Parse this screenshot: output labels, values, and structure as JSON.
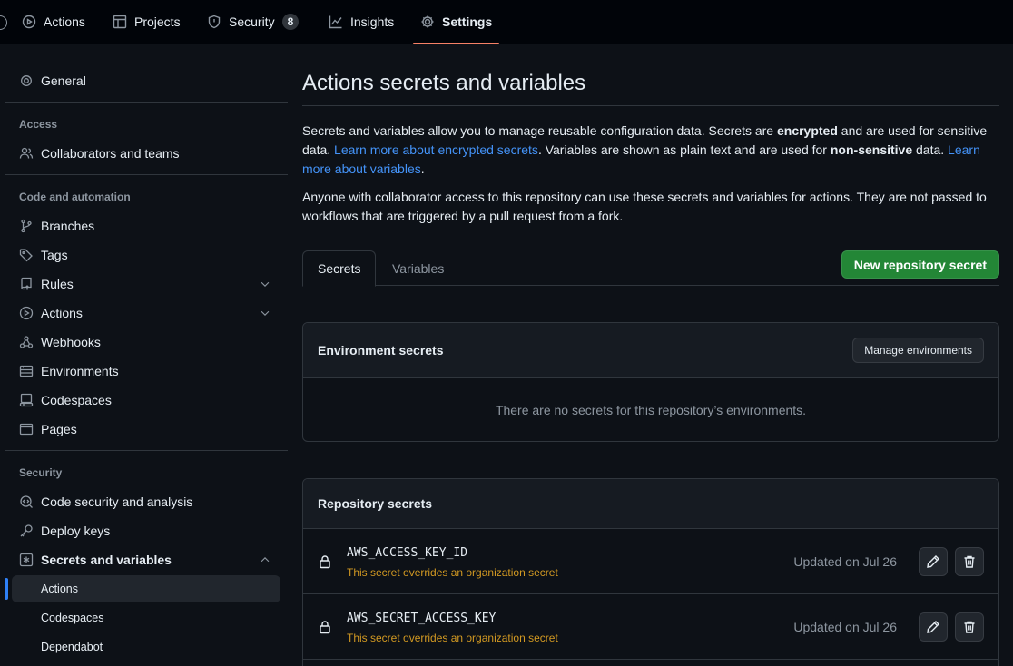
{
  "nav": {
    "tabs": [
      {
        "label": "Actions",
        "icon": "play-icon"
      },
      {
        "label": "Projects",
        "icon": "table-icon"
      },
      {
        "label": "Security",
        "icon": "shield-icon",
        "count": "8"
      },
      {
        "label": "Insights",
        "icon": "graph-icon"
      },
      {
        "label": "Settings",
        "icon": "gear-icon",
        "active": true
      }
    ]
  },
  "sidebar": {
    "general": "General",
    "sections": {
      "access": "Access",
      "code_automation": "Code and automation",
      "security": "Security"
    },
    "items": {
      "collaborators": "Collaborators and teams",
      "branches": "Branches",
      "tags": "Tags",
      "rules": "Rules",
      "actions": "Actions",
      "webhooks": "Webhooks",
      "environments": "Environments",
      "codespaces": "Codespaces",
      "pages": "Pages",
      "code_security": "Code security and analysis",
      "deploy_keys": "Deploy keys",
      "secrets_variables": "Secrets and variables"
    },
    "sub_items": [
      "Actions",
      "Codespaces",
      "Dependabot"
    ],
    "selected_sub": "Actions"
  },
  "main": {
    "title": "Actions secrets and variables",
    "intro": {
      "p1_a": "Secrets and variables allow you to manage reusable configuration data. Secrets are ",
      "p1_b": "encrypted",
      "p1_c": " and are used for sensitive data. ",
      "p1_link1": "Learn more about encrypted secrets",
      "p1_d": ". Variables are shown as plain text and are used for ",
      "p1_e": "non-sensitive",
      "p1_f": " data. ",
      "p1_link2": "Learn more about variables",
      "p1_g": ".",
      "p2": "Anyone with collaborator access to this repository can use these secrets and variables for actions. They are not passed to workflows that are triggered by a pull request from a fork."
    },
    "tabs": {
      "secrets": "Secrets",
      "variables": "Variables"
    },
    "new_secret_button": "New repository secret",
    "env_secrets": {
      "title": "Environment secrets",
      "manage_button": "Manage environments",
      "empty": "There are no secrets for this repository’s environments."
    },
    "repo_secrets": {
      "title": "Repository secrets",
      "rows": [
        {
          "name": "AWS_ACCESS_KEY_ID",
          "note": "This secret overrides an organization secret",
          "updated": "Updated on Jul 26"
        },
        {
          "name": "AWS_SECRET_ACCESS_KEY",
          "note": "This secret overrides an organization secret",
          "updated": "Updated on Jul 26"
        }
      ]
    }
  },
  "colors": {
    "background": "#0d1117",
    "accent_link": "#4493f8",
    "primary_button": "#238636",
    "warning_text": "#d29922",
    "active_tab_underline": "#f78166"
  }
}
